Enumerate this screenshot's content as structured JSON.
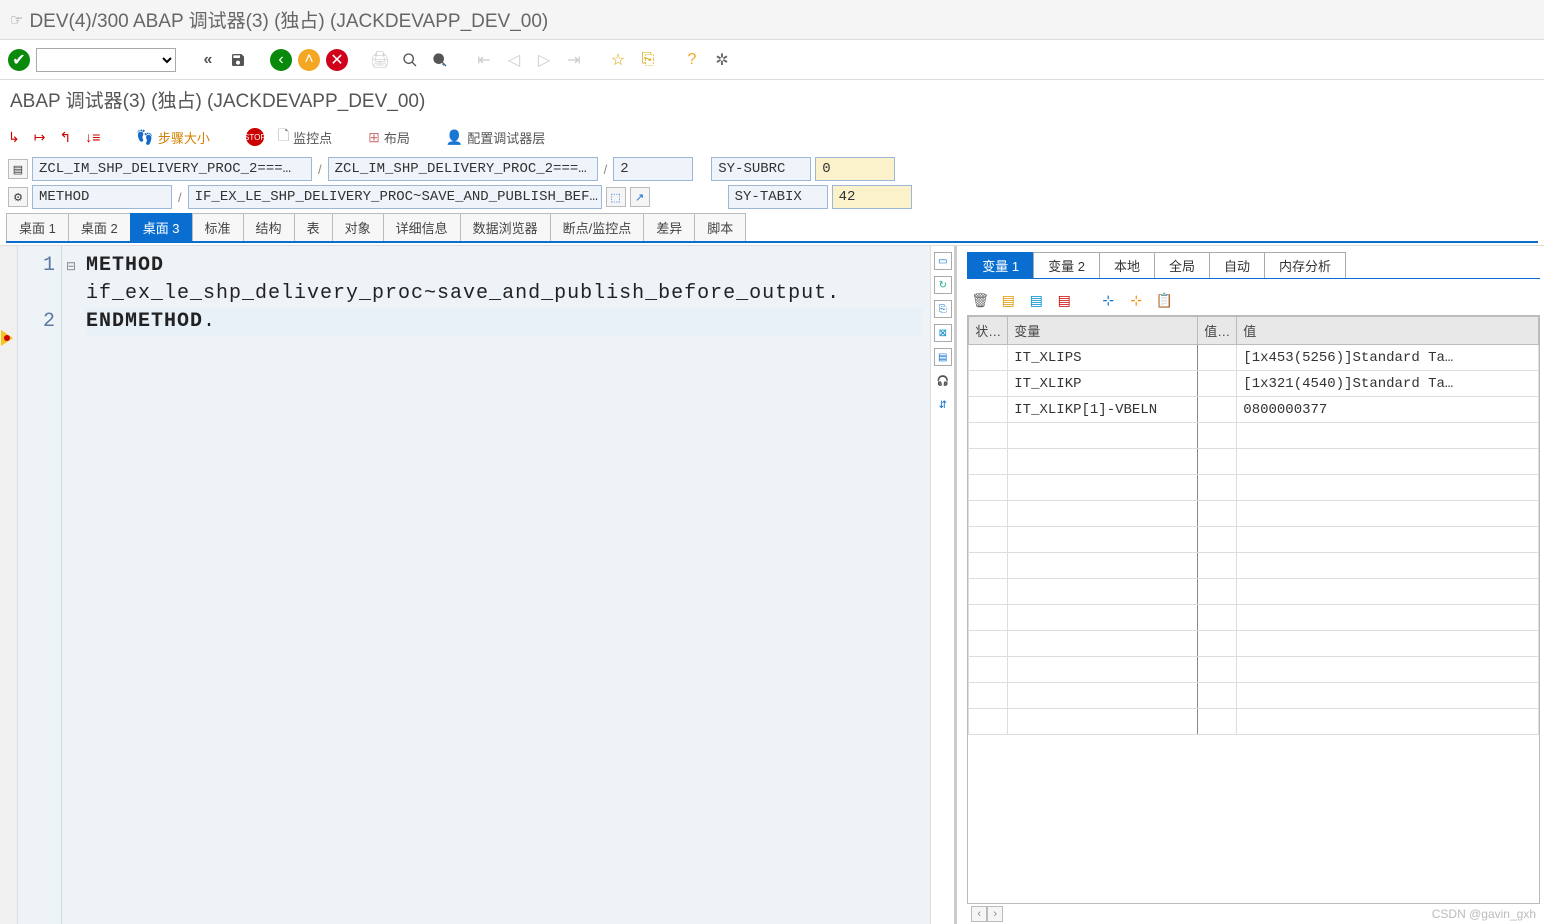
{
  "window": {
    "title": "DEV(4)/300 ABAP 调试器(3)  (独占) (JACKDEVAPP_DEV_00)"
  },
  "subtitle": "ABAP 调试器(3)  (独占) (JACKDEVAPP_DEV_00)",
  "toolbar2": {
    "step_size": "步骤大小",
    "watchpoint": "监控点",
    "layout": "布局",
    "config": "配置调试器层"
  },
  "context": {
    "class1": "ZCL_IM_SHP_DELIVERY_PROC_2===…",
    "class2": "ZCL_IM_SHP_DELIVERY_PROC_2===…",
    "line": "2",
    "method_label": "METHOD",
    "method_full": "IF_EX_LE_SHP_DELIVERY_PROC~SAVE_AND_PUBLISH_BEF…",
    "sy_subrc_label": "SY-SUBRC",
    "sy_subrc_val": "0",
    "sy_tabix_label": "SY-TABIX",
    "sy_tabix_val": "42"
  },
  "tabs": [
    "桌面 1",
    "桌面 2",
    "桌面 3",
    "标准",
    "结构",
    "表",
    "对象",
    "详细信息",
    "数据浏览器",
    "断点/监控点",
    "差异",
    "脚本"
  ],
  "tabs_active": 2,
  "code": {
    "lines": [
      "1",
      "2"
    ],
    "line1_kw": "METHOD",
    "body": "if_ex_le_shp_delivery_proc~save_and_publish_before_output.",
    "line2_kw": "ENDMETHOD",
    "dot": "."
  },
  "var_tabs": [
    "变量 1",
    "变量 2",
    "本地",
    "全局",
    "自动",
    "内存分析"
  ],
  "var_tabs_active": 0,
  "var_headers": {
    "status": "状…",
    "name": "变量",
    "val_short": "值…",
    "val": "值"
  },
  "variables": [
    {
      "name": "IT_XLIPS",
      "val": "[1x453(5256)]Standard Ta…"
    },
    {
      "name": "IT_XLIKP",
      "val": "[1x321(4540)]Standard Ta…"
    },
    {
      "name": "IT_XLIKP[1]-VBELN",
      "val": "0800000377"
    }
  ],
  "watermark": "CSDN @gavin_gxh"
}
